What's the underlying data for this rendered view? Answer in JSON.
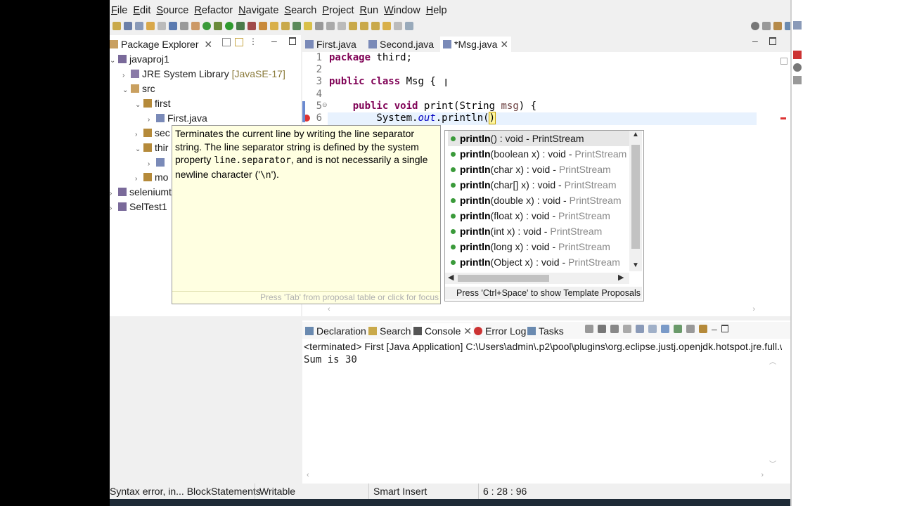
{
  "menu": [
    "File",
    "Edit",
    "Source",
    "Refactor",
    "Navigate",
    "Search",
    "Project",
    "Run",
    "Window",
    "Help"
  ],
  "explorer": {
    "title": "Package Explorer",
    "items": [
      {
        "label": "javaproj1",
        "depth": 0
      },
      {
        "label": "JRE System Library",
        "suffix": "[JavaSE-17]",
        "depth": 1
      },
      {
        "label": "src",
        "depth": 1
      },
      {
        "label": "first",
        "depth": 2
      },
      {
        "label": "First.java",
        "depth": 3
      },
      {
        "label": "sec",
        "depth": 2
      },
      {
        "label": "thir",
        "depth": 2
      },
      {
        "label": "",
        "depth": 3
      },
      {
        "label": "mo",
        "depth": 2
      },
      {
        "label": "seleniumt",
        "depth": 0
      },
      {
        "label": "SelTest1",
        "depth": 0
      }
    ]
  },
  "editor": {
    "tabs": [
      "First.java",
      "Second.java",
      "*Msg.java"
    ],
    "lines": [
      {
        "n": "1",
        "text": "package third;"
      },
      {
        "n": "2",
        "text": ""
      },
      {
        "n": "3",
        "text": "public class Msg {"
      },
      {
        "n": "4",
        "text": ""
      },
      {
        "n": "5",
        "text": "    public void print(String msg) {"
      },
      {
        "n": "6",
        "text": "        System.out.println()"
      }
    ]
  },
  "javadoc": {
    "text1": "Terminates the current line by writing the line separator string. The line separator string is defined by the system property ",
    "code1": "line.separator",
    "text2": ", and is not necessarily a single newline character ('",
    "code2": "\\n",
    "text3": "').",
    "footer": "Press 'Tab' from proposal table or click for focus"
  },
  "proposals": {
    "items": [
      {
        "name": "println",
        "sig": "() : void",
        "type": "PrintStream"
      },
      {
        "name": "println",
        "sig": "(boolean x) : void",
        "type": "PrintStream"
      },
      {
        "name": "println",
        "sig": "(char x) : void",
        "type": "PrintStream"
      },
      {
        "name": "println",
        "sig": "(char[] x) : void",
        "type": "PrintStream"
      },
      {
        "name": "println",
        "sig": "(double x) : void",
        "type": "PrintStream"
      },
      {
        "name": "println",
        "sig": "(float x) : void",
        "type": "PrintStream"
      },
      {
        "name": "println",
        "sig": "(int x) : void",
        "type": "PrintStream"
      },
      {
        "name": "println",
        "sig": "(long x) : void",
        "type": "PrintStream"
      },
      {
        "name": "println",
        "sig": "(Object x) : void",
        "type": "PrintStream"
      }
    ],
    "footer": "Press 'Ctrl+Space' to show Template Proposals"
  },
  "console": {
    "tabs": [
      "Declaration",
      "Search",
      "Console",
      "Error Log",
      "Tasks"
    ],
    "header": "<terminated> First [Java Application] C:\\Users\\admin\\.p2\\pool\\plugins\\org.eclipse.justj.openjdk.hotspot.jre.full.w",
    "output": "Sum is 30"
  },
  "status": {
    "message": "Syntax error, in... BlockStatements",
    "mode": "Writable",
    "insert": "Smart Insert",
    "position": "6 : 28 : 96"
  }
}
